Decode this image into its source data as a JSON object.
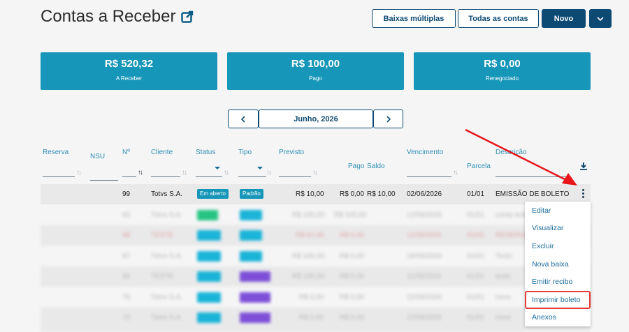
{
  "page": {
    "title": "Contas a Receber"
  },
  "toolbar": {
    "baixas_multiplas": "Baixas múltiplas",
    "todas_contas": "Todas as contas",
    "novo": "Novo"
  },
  "summary": [
    {
      "value": "R$ 520,32",
      "label": "A Receber"
    },
    {
      "value": "R$ 100,00",
      "label": "Pago"
    },
    {
      "value": "R$ 0,00",
      "label": "Renegociado"
    }
  ],
  "period": {
    "label": "Junho, 2026"
  },
  "columns": {
    "reserva": "Reserva",
    "nsu": "NSU",
    "numero": "Nº",
    "cliente": "Cliente",
    "status": "Status",
    "tipo": "Tipo",
    "previsto": "Previsto",
    "pago": "Pago",
    "saldo": "Saldo",
    "vencimento": "Vencimento",
    "parcela": "Parcela",
    "descricao": "Descrição"
  },
  "row": {
    "numero": "99",
    "cliente": "Totvs S.A.",
    "status": "Em aberto",
    "tipo": "Padrão",
    "previsto": "R$ 10,00",
    "pago": "R$ 0,00",
    "saldo": "R$ 10,00",
    "vencimento": "02/06/2026",
    "parcela": "01/01",
    "descricao": "EMISSÃO DE BOLETO"
  },
  "blurred_rows": [
    {
      "numero": "93",
      "cliente": "Totvs S.A.",
      "previsto": "R$ 100,00",
      "pago": "R$ 100,00",
      "vencimento": "12/06/2026",
      "parcela": "01/01",
      "descricao": "conta teste"
    },
    {
      "numero": "88",
      "cliente": "TESTE",
      "previsto": "R$ 67,00",
      "pago": "R$ 0,00",
      "vencimento": "11/06/2026",
      "parcela": "01/01",
      "descricao": "RESERVA"
    },
    {
      "numero": "87",
      "cliente": "Totvs S.A.",
      "previsto": "R$ 100,00",
      "pago": "R$ 0,00",
      "vencimento": "18/06/2026",
      "parcela": "01/01",
      "descricao": "Teste"
    },
    {
      "numero": "86",
      "cliente": "TESTE",
      "previsto": "R$ 100,00",
      "pago": "R$ 0,00",
      "vencimento": "11/06/2026",
      "parcela": "01/01",
      "descricao": "teste"
    },
    {
      "numero": "78",
      "cliente": "Totvs S.A.",
      "previsto": "R$ 0,00",
      "pago": "R$ 0,00",
      "vencimento": "22/06/2026",
      "parcela": "01/01",
      "descricao": "novo"
    },
    {
      "numero": "73",
      "cliente": "Totvs S.A.",
      "previsto": "R$ 0,00",
      "pago": "R$ 0,00",
      "vencimento": "22/06/2026",
      "parcela": "01/01",
      "descricao": "novo"
    }
  ],
  "context_menu": [
    "Editar",
    "Visualizar",
    "Excluir",
    "Nova baixa",
    "Emitir recibo",
    "Imprimir boleto",
    "Anexos"
  ],
  "colors": {
    "accent": "#0c4a73",
    "card": "#1696b8",
    "highlight": "#e53935",
    "arrow": "#e8141a"
  }
}
